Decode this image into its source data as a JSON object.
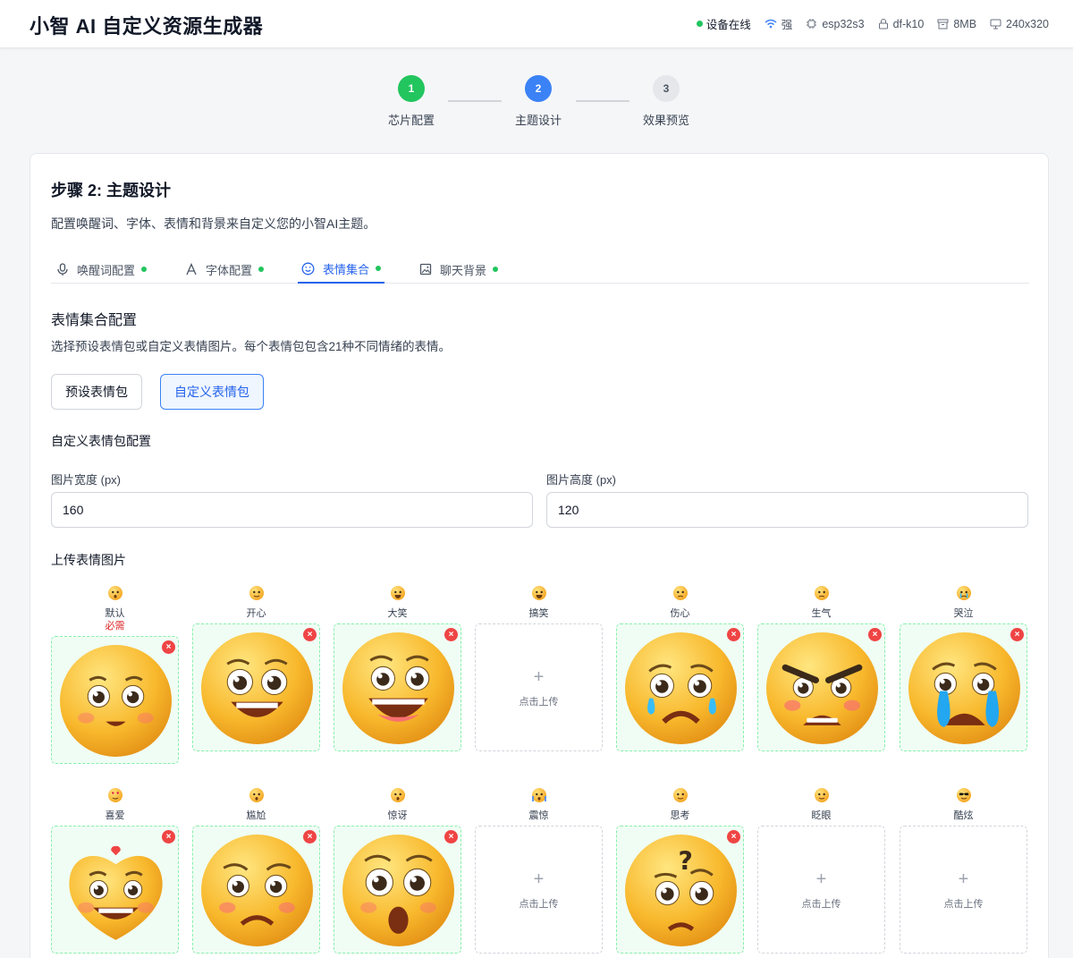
{
  "header": {
    "title": "小智 AI 自定义资源生成器",
    "status": {
      "online": "设备在线",
      "signal": "强",
      "chip": "esp32s3",
      "board": "df-k10",
      "flash": "8MB",
      "resolution": "240x320"
    }
  },
  "stepper": {
    "steps": [
      {
        "num": "1",
        "label": "芯片配置",
        "state": "done"
      },
      {
        "num": "2",
        "label": "主题设计",
        "state": "active"
      },
      {
        "num": "3",
        "label": "效果预览",
        "state": "pending"
      }
    ]
  },
  "card": {
    "title": "步骤 2: 主题设计",
    "desc": "配置唤醒词、字体、表情和背景来自定义您的小智AI主题。"
  },
  "tabs": [
    {
      "label": "唤醒词配置",
      "icon": "mic-icon"
    },
    {
      "label": "字体配置",
      "icon": "font-icon"
    },
    {
      "label": "表情集合",
      "icon": "smile-icon",
      "active": true
    },
    {
      "label": "聊天背景",
      "icon": "image-icon"
    }
  ],
  "section": {
    "title": "表情集合配置",
    "desc": "选择预设表情包或自定义表情图片。每个表情包包含21种不同情绪的表情。",
    "preset_label": "预设表情包",
    "custom_label": "自定义表情包"
  },
  "custom": {
    "subhead": "自定义表情包配置",
    "width_label": "图片宽度 (px)",
    "width_value": "160",
    "height_label": "图片高度 (px)",
    "height_value": "120",
    "upload_title": "上传表情图片",
    "upload_text": "点击上传",
    "required_text": "必需",
    "remove_symbol": "×",
    "plus_symbol": "+"
  },
  "emotions": [
    {
      "name": "默认",
      "emoji": "😶",
      "uploaded": true,
      "required": true,
      "face": "neutral"
    },
    {
      "name": "开心",
      "emoji": "🙂",
      "uploaded": true,
      "face": "happy"
    },
    {
      "name": "大笑",
      "emoji": "😆",
      "uploaded": true,
      "face": "laugh"
    },
    {
      "name": "搞笑",
      "emoji": "😂",
      "uploaded": false
    },
    {
      "name": "伤心",
      "emoji": "😔",
      "uploaded": true,
      "face": "sad"
    },
    {
      "name": "生气",
      "emoji": "😠",
      "uploaded": true,
      "face": "angry"
    },
    {
      "name": "哭泣",
      "emoji": "😭",
      "uploaded": true,
      "face": "cry"
    },
    {
      "name": "喜爱",
      "emoji": "😍",
      "uploaded": true,
      "face": "love"
    },
    {
      "name": "尴尬",
      "emoji": "😳",
      "uploaded": true,
      "face": "embarrassed"
    },
    {
      "name": "惊讶",
      "emoji": "😯",
      "uploaded": true,
      "face": "surprised"
    },
    {
      "name": "震惊",
      "emoji": "😱",
      "uploaded": false
    },
    {
      "name": "思考",
      "emoji": "🤔",
      "uploaded": true,
      "face": "thinking"
    },
    {
      "name": "眨眼",
      "emoji": "😉",
      "uploaded": false
    },
    {
      "name": "酷炫",
      "emoji": "😎",
      "uploaded": false
    }
  ],
  "colors": {
    "accent": "#2563eb",
    "done": "#22c55e",
    "danger": "#ef4444",
    "face_base": "#f5b82e"
  }
}
